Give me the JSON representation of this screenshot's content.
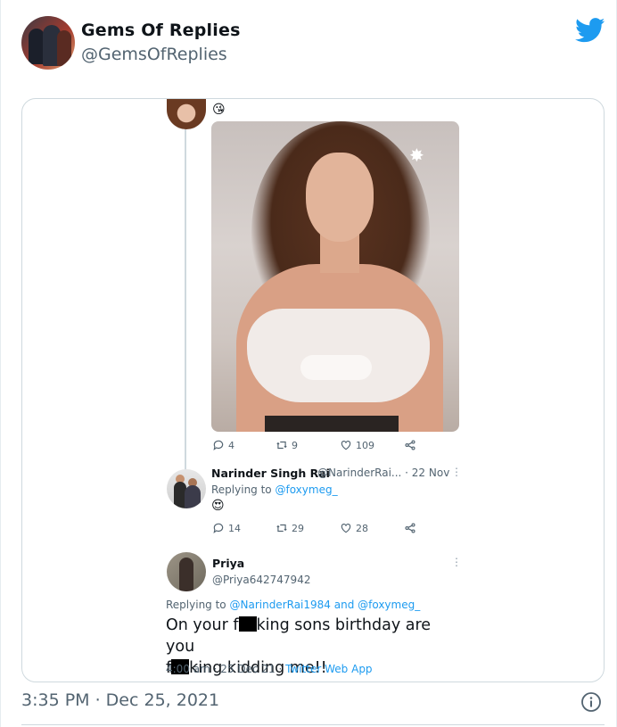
{
  "author": {
    "name": "Gems Of Replies",
    "handle": "@GemsOfReplies"
  },
  "embedded": {
    "top_tweet": {
      "emoji": "😘",
      "actions": {
        "replies": "4",
        "retweets": "9",
        "likes": "109"
      }
    },
    "narinder": {
      "name": "Narinder Singh Rai",
      "handle_date": "@NarinderRai... · 22 Nov",
      "replying_prefix": "Replying to",
      "replying_to": "@foxymeg_",
      "emoji": "😍",
      "actions": {
        "replies": "14",
        "retweets": "29",
        "likes": "28"
      }
    },
    "priya": {
      "name": "Priya",
      "handle": "@Priya642747942",
      "replying_prefix": "Replying to",
      "replying_to": "@NarinderRai1984 and @foxymeg_",
      "text_part1": "On your f",
      "text_part2": "king sons birthday are you",
      "text_part3": "f",
      "text_part4": "king kidding me!!",
      "time_date": "4:00 am · 25 Dec 21 · ",
      "source": "Twitter Web App"
    }
  },
  "footer": {
    "timestamp": "3:35 PM · Dec 25, 2021"
  },
  "colors": {
    "accent": "#1d9bf0",
    "secondary_text": "#536471",
    "border": "#cfd9de"
  },
  "icons": [
    "twitter-bird-icon",
    "reply-icon",
    "retweet-icon",
    "like-icon",
    "share-icon",
    "info-icon",
    "more-icon"
  ]
}
